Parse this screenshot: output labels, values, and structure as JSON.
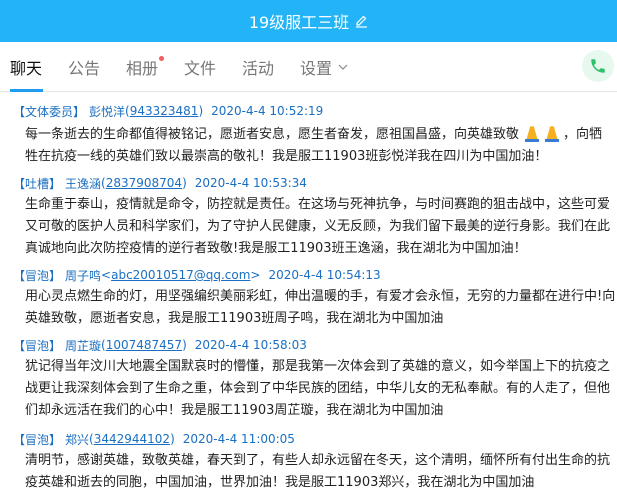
{
  "window": {
    "title": "19级服工三班"
  },
  "tabs": [
    {
      "label": "聊天"
    },
    {
      "label": "公告"
    },
    {
      "label": "相册"
    },
    {
      "label": "文件"
    },
    {
      "label": "活动"
    },
    {
      "label": "设置"
    }
  ],
  "icons": {
    "edit": "edit-icon",
    "phone": "phone-icon",
    "chevron": "chevron-down-icon",
    "pray": "folded-hands-icon"
  },
  "colors": {
    "titlebar": "#22b4f6",
    "accent": "#1f9cf0",
    "sender": "#1a6fc2",
    "phone": "#2ec06b",
    "dot": "#f25d5d"
  },
  "messages": [
    {
      "badge": "【文体委员】",
      "name": "彭悦洋",
      "qq": "943323481",
      "time": "2020-4-4 10:52:19",
      "lines": [
        {
          "pre": "每一条逝去的生命都值得被铭记，愿逝者安息，愿生者奋发，愿祖国昌盛，向英雄致敬",
          "post": "，向牺"
        },
        {
          "pre": "牲在抗疫一线的英雄们致以最崇高的敬礼！我是服工11903班彭悦洋我在四川为中国加油！"
        }
      ]
    },
    {
      "badge": "【吐槽】",
      "name": "王逸涵",
      "qq": "2837908704",
      "time": "2020-4-4 10:53:34",
      "lines": [
        {
          "pre": "生命重于泰山，疫情就是命令，防控就是责任。在这场与死神抗争，与时间赛跑的狙击战中，这些可爱"
        },
        {
          "pre": "又可敬的医护人员和科学家们，为了守护人民健康，义无反顾，为我们留下最美的逆行身影。我们在此"
        },
        {
          "pre": "真诚地向此次防控疫情的逆行者致敬!我是服工11903班王逸涵，我在湖北为中国加油！"
        }
      ]
    },
    {
      "badge": "【冒泡】",
      "name": "周子鸣",
      "email": "abc20010517@qq.com",
      "time": "2020-4-4 10:54:13",
      "lines": [
        {
          "pre": "用心灵点燃生命的灯，用坚强编织美丽彩虹，伸出温暖的手，有爱才会永恒，无穷的力量都在进行中!向"
        },
        {
          "pre": "英雄致敬，愿逝者安息，我是服工11903班周子鸣，我在湖北为中国加油"
        }
      ]
    },
    {
      "badge": "【冒泡】",
      "name": "周芷璇",
      "qq": "1007487457",
      "time": "2020-4-4 10:58:03",
      "lines": [
        {
          "pre": "犹记得当年汶川大地震全国默哀时的懵懂，那是我第一次体会到了英雄的意义，如今举国上下的抗疫之"
        },
        {
          "pre": "战更让我深刻体会到了生命之重，体会到了中华民族的团结，中华儿女的无私奉献。有的人走了，但他"
        },
        {
          "pre": "们却永远活在我们的心中！我是服工11903周芷璇，我在湖北为中国加油"
        }
      ]
    },
    {
      "badge": "【冒泡】",
      "name": "郑兴",
      "qq": "3442944102",
      "time": "2020-4-4 11:00:05",
      "lines": [
        {
          "pre": "清明节，感谢英雄，致敬英雄，春天到了，有些人却永远留在冬天，这个清明，缅怀所有付出生命的抗"
        },
        {
          "pre": "疫英雄和逝去的同胞，中国加油，世界加油！我是服工11903郑兴，我在湖北为中国加油"
        }
      ]
    }
  ]
}
